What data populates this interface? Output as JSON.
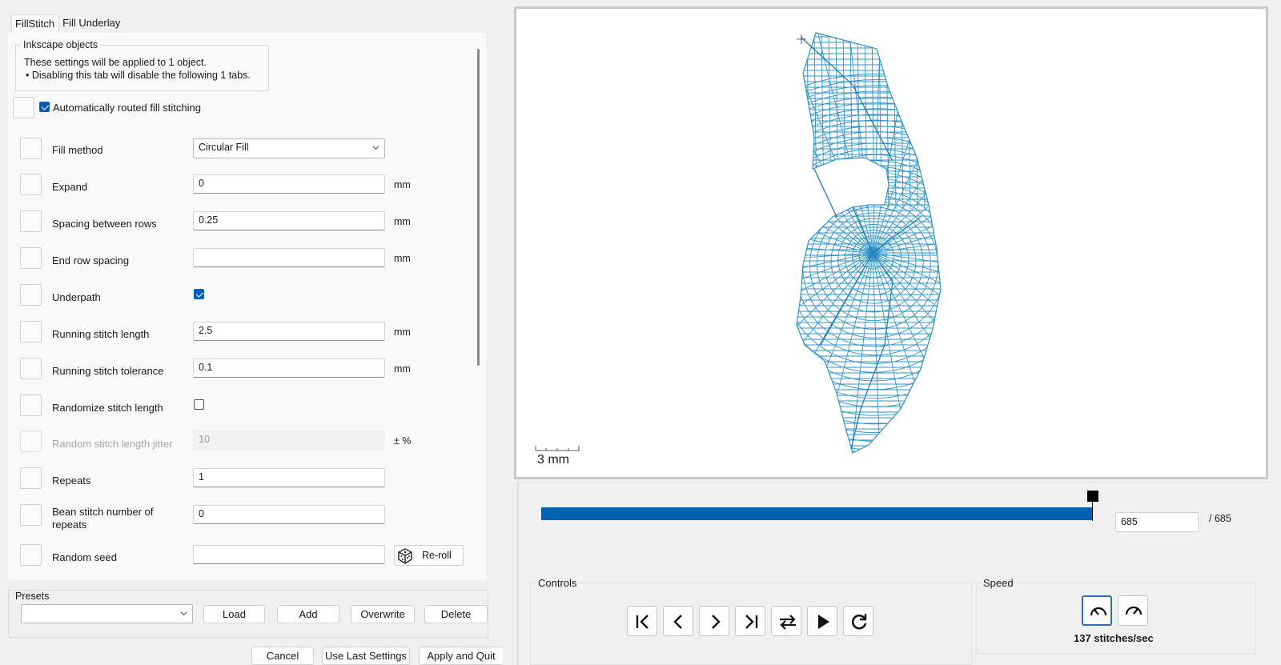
{
  "tabs": [
    {
      "label": "FillStitch",
      "active": true
    },
    {
      "label": "Fill Underlay",
      "active": false
    }
  ],
  "info_group": {
    "legend": "Inkscape objects",
    "line1": "These settings will be applied to 1 object.",
    "line2": "• Disabling this tab will disable the following 1 tabs."
  },
  "auto_routed": {
    "label": "Automatically routed fill stitching",
    "checked": true
  },
  "params": {
    "fill_method": {
      "label": "Fill method",
      "value": "Circular Fill"
    },
    "expand": {
      "label": "Expand",
      "value": "0",
      "unit": "mm"
    },
    "spacing": {
      "label": "Spacing between rows",
      "value": "0.25",
      "unit": "mm"
    },
    "end_row_spacing": {
      "label": "End row spacing",
      "value": "",
      "unit": "mm"
    },
    "underpath": {
      "label": "Underpath",
      "checked": true
    },
    "running_length": {
      "label": "Running stitch length",
      "value": "2.5",
      "unit": "mm"
    },
    "running_tolerance": {
      "label": "Running stitch tolerance",
      "value": "0.1",
      "unit": "mm"
    },
    "randomize": {
      "label": "Randomize stitch length",
      "checked": false
    },
    "jitter": {
      "label": "Random stitch length jitter",
      "value": "10",
      "unit": "± %"
    },
    "repeats": {
      "label": "Repeats",
      "value": "1"
    },
    "bean_line1": "Bean stitch number of",
    "bean_line2": "repeats",
    "bean_value": "0",
    "seed": {
      "label": "Random seed",
      "value": "",
      "button": "Re-roll"
    }
  },
  "presets": {
    "legend": "Presets",
    "value": "",
    "load": "Load",
    "add": "Add",
    "overwrite": "Overwrite",
    "delete": "Delete"
  },
  "footer": {
    "cancel": "Cancel",
    "use_last": "Use Last Settings",
    "apply_quit": "Apply and Quit"
  },
  "preview": {
    "scale_label": "3 mm",
    "stitch_color": "#2e93c6",
    "current_stitch": "685",
    "total_stitches": "/ 685",
    "progress_fraction": 1.0
  },
  "controls": {
    "legend": "Controls",
    "buttons": [
      "skip-to-start-icon",
      "step-back-icon",
      "step-forward-icon",
      "skip-to-end-icon",
      "swap-direction-icon",
      "play-icon",
      "restart-icon"
    ]
  },
  "speed": {
    "legend": "Speed",
    "text": "137 stitches/sec"
  },
  "accent_color": "#0063b1"
}
